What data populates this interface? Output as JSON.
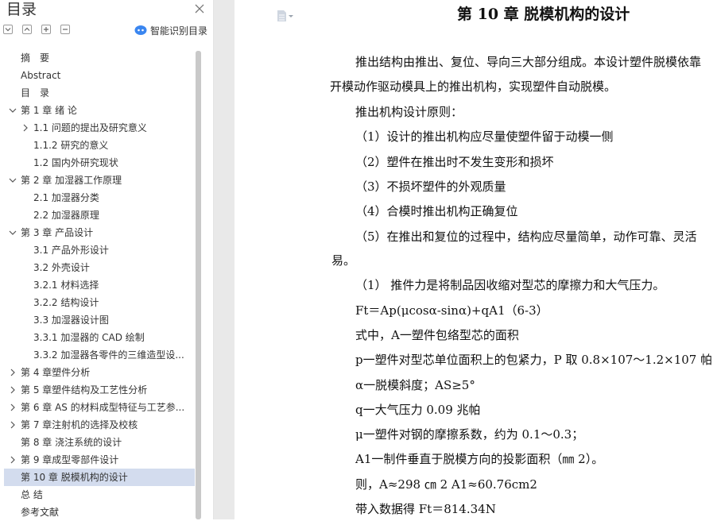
{
  "sidebar": {
    "title": "目录",
    "ai_label": "智能识别目录",
    "toc": [
      {
        "label": "摘　要",
        "level": 1,
        "chevron": "none"
      },
      {
        "label": "Abstract",
        "level": 1,
        "chevron": "none"
      },
      {
        "label": "目　录",
        "level": 1,
        "chevron": "none"
      },
      {
        "label": "第 1 章  绪  论",
        "level": 1,
        "chevron": "down"
      },
      {
        "label": "1.1 问题的提出及研究意义",
        "level": 2,
        "chevron": "right"
      },
      {
        "label": "1.1.2 研究的意义",
        "level": 3,
        "chevron": "none"
      },
      {
        "label": "1.2 国内外研究现状",
        "level": 3,
        "chevron": "none"
      },
      {
        "label": "第 2 章  加湿器工作原理",
        "level": 1,
        "chevron": "down"
      },
      {
        "label": "2.1 加湿器分类",
        "level": 3,
        "chevron": "none"
      },
      {
        "label": "2.2 加湿器原理",
        "level": 3,
        "chevron": "none"
      },
      {
        "label": "第 3 章  产品设计",
        "level": 1,
        "chevron": "down"
      },
      {
        "label": "3.1  产品外形设计",
        "level": 3,
        "chevron": "none"
      },
      {
        "label": "3.2  外壳设计",
        "level": 3,
        "chevron": "none"
      },
      {
        "label": "3.2.1  材料选择",
        "level": 3,
        "chevron": "none"
      },
      {
        "label": "3.2.2  结构设计",
        "level": 3,
        "chevron": "none"
      },
      {
        "label": "3.3  加湿器设计图",
        "level": 3,
        "chevron": "none"
      },
      {
        "label": "3.3.1 加湿器的 CAD 绘制",
        "level": 3,
        "chevron": "none"
      },
      {
        "label": "3.3.2 加湿器各零件的三维造型设...",
        "level": 3,
        "chevron": "none"
      },
      {
        "label": "第 4 章塑件分析",
        "level": 1,
        "chevron": "right"
      },
      {
        "label": "第 5 章塑件结构及工艺性分析",
        "level": 1,
        "chevron": "right"
      },
      {
        "label": "第 6 章  AS 的材料成型特征与工艺参...",
        "level": 1,
        "chevron": "right"
      },
      {
        "label": "第 7 章注射机的选择及校核",
        "level": 1,
        "chevron": "right"
      },
      {
        "label": "第 8 章  浇注系统的设计",
        "level": 1,
        "chevron": "none"
      },
      {
        "label": "第 9 章成型零部件设计",
        "level": 1,
        "chevron": "right"
      },
      {
        "label": "第 10 章  脱模机构的设计",
        "level": 1,
        "chevron": "none",
        "active": true
      },
      {
        "label": "总  结",
        "level": 1,
        "chevron": "none"
      },
      {
        "label": "参考文献",
        "level": 1,
        "chevron": "none"
      }
    ]
  },
  "document": {
    "title": "第 10 章  脱模机构的设计",
    "lines": [
      "推出结构由推出、复位、导向三大部分组成。本设计塑件脱模依靠",
      "开模动作驱动模具上的推出机构，实现塑件自动脱模。",
      "推出机构设计原则：",
      "（1）设计的推出机构应尽量使塑件留于动模一侧",
      "（2）塑件在推出时不发生变形和损坏",
      "（3）不损坏塑件的外观质量",
      "（4）合模时推出机构正确复位",
      "（5）在推出和复位的过程中，结构应尽量简单，动作可靠、灵活",
      "易。",
      "（1）  推件力是将制品因收缩对型芯的摩擦力和大气压力。",
      "Ft＝Ap(μcosα-sinα)+qA1（6-3）",
      "式中，A一塑件包络型芯的面积",
      "p一塑件对型芯单位面积上的包紧力，P 取 0.8×107～1.2×107  帕",
      "α一脱模斜度；AS≥5°",
      "q一大气压力 0.09 兆帕",
      "μ一塑件对钢的摩擦系数，约为 0.1～0.3；",
      "A1一制件垂直于脱模方向的投影面积（㎜ 2）。",
      "则，A≈298 ㎝ 2    A1≈60.76cm2",
      "带入数据得 Ft＝814.34N"
    ]
  }
}
